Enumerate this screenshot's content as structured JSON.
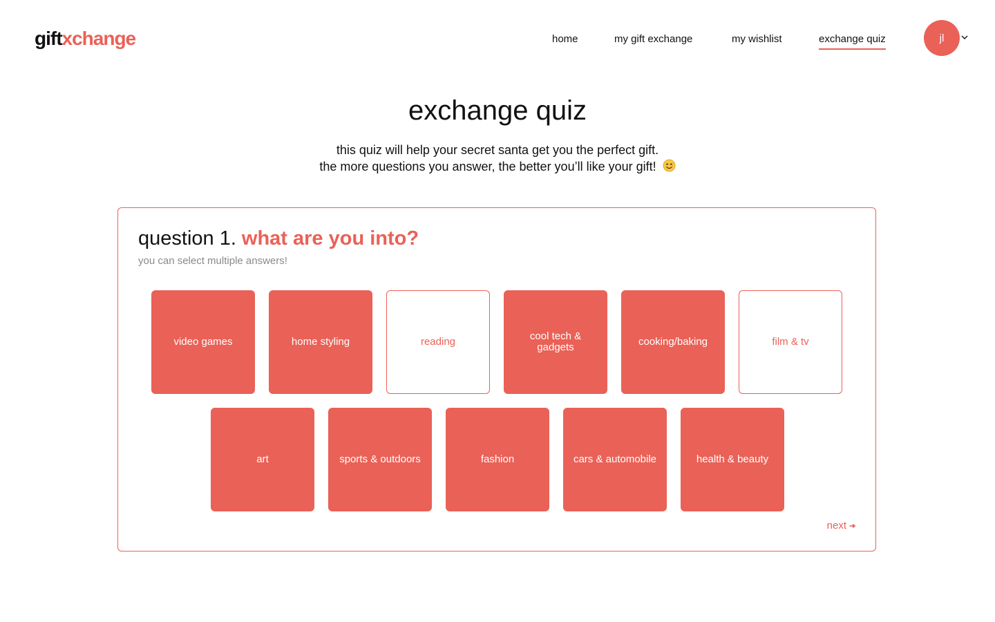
{
  "brand": {
    "logo_part1": "gift",
    "logo_part2": "xchange",
    "accent_color": "#ea6157"
  },
  "nav": {
    "items": [
      {
        "label": "home",
        "active": false
      },
      {
        "label": "my gift exchange",
        "active": false
      },
      {
        "label": "my wishlist",
        "active": false
      },
      {
        "label": "exchange quiz",
        "active": true
      }
    ]
  },
  "user": {
    "initials": "jl",
    "menu_icon": "chevron-down-icon"
  },
  "page": {
    "title": "exchange quiz",
    "subtitle_line1": "this quiz will help your secret santa get you the perfect gift.",
    "subtitle_line2": "the more questions you answer, the better you’ll like your gift!",
    "subtitle_emoji": "smiling-face-icon"
  },
  "question": {
    "number": "question 1.",
    "text": "what are you into?",
    "hint": "you can select multiple answers!",
    "options": [
      {
        "label": "video games",
        "selected": true
      },
      {
        "label": "home styling",
        "selected": true
      },
      {
        "label": "reading",
        "selected": false
      },
      {
        "label": "cool tech & gadgets",
        "selected": true
      },
      {
        "label": "cooking/baking",
        "selected": true
      },
      {
        "label": "film & tv",
        "selected": false
      },
      {
        "label": "art",
        "selected": true
      },
      {
        "label": "sports & outdoors",
        "selected": true
      },
      {
        "label": "fashion",
        "selected": true
      },
      {
        "label": "cars & automobile",
        "selected": true
      },
      {
        "label": "health & beauty",
        "selected": true
      }
    ],
    "next_label": "next",
    "next_icon": "arrow-right-icon"
  }
}
